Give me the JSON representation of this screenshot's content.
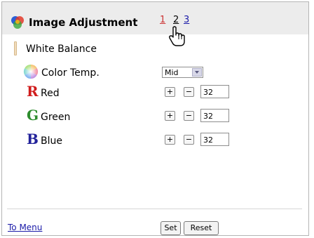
{
  "header": {
    "title": "Image Adjustment",
    "pages": [
      "1",
      "2",
      "3"
    ],
    "active_page": "1"
  },
  "section": {
    "label": "White Balance"
  },
  "rows": [
    {
      "label": "Color Temp.",
      "icon": "color-wheel-icon"
    },
    {
      "label": "Red",
      "letter": "R",
      "color": "#d01c1c",
      "value": "32"
    },
    {
      "label": "Green",
      "letter": "G",
      "color": "#2d8c2d",
      "value": "32"
    },
    {
      "label": "Blue",
      "letter": "B",
      "color": "#22229a",
      "value": "32"
    }
  ],
  "color_temp_select": {
    "value": "Mid"
  },
  "stepper": {
    "plus": "+",
    "minus": "−"
  },
  "footer": {
    "menu_link": "To Menu",
    "set_label": "Set",
    "reset_label": "Reset"
  }
}
